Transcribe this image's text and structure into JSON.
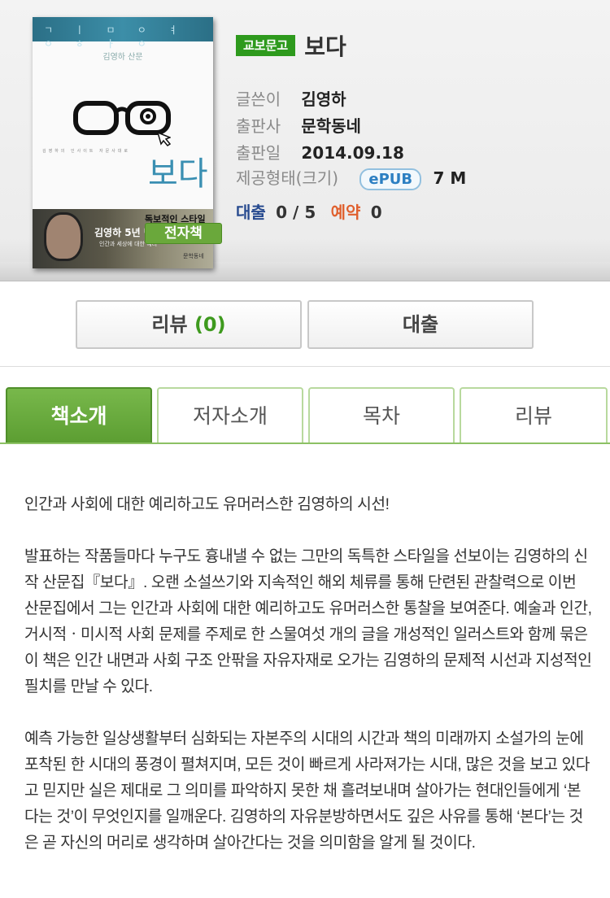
{
  "book": {
    "cover": {
      "top_band_text": "ㄱ ㅣ ㅁ ㅇ ㅕ ㅇ ㅎ ㅏ ㅇ",
      "author_line": "김영하 산문",
      "subtitle_line": "김영하의 인사이트 자문사대로",
      "title": "보다",
      "banner_line1": "독보적인 스타일",
      "banner_line2": "김영하 5년 만",
      "banner_line3": "인간과 세상에 대한 예리",
      "publisher_mark": "문학동네"
    },
    "ebook_badge": "전자책",
    "badge": "교보문고",
    "title": "보다",
    "author_label": "글쓴이",
    "author": "김영하",
    "publisher_label": "출판사",
    "publisher": "문학동네",
    "pubdate_label": "출판일",
    "pubdate": "2014.09.18",
    "format_label": "제공형태(크기)",
    "format": "ePUB",
    "size": "7 M",
    "loan_label": "대출",
    "loan_value": "0 / 5",
    "reserve_label": "예약",
    "reserve_value": "0"
  },
  "actions": {
    "review_label": "리뷰",
    "review_count": "(0)",
    "loan_button": "대출"
  },
  "tabs": [
    {
      "label": "책소개",
      "active": true
    },
    {
      "label": "저자소개",
      "active": false
    },
    {
      "label": "목차",
      "active": false
    },
    {
      "label": "리뷰",
      "active": false
    }
  ],
  "description": {
    "p1": "인간과 사회에 대한 예리하고도 유머러스한 김영하의 시선!",
    "p2": "발표하는 작품들마다 누구도 흉내낼 수 없는 그만의 독특한 스타일을 선보이는 김영하의 신작 산문집『보다』. 오랜 소설쓰기와 지속적인 해외 체류를 통해 단련된 관찰력으로 이번 산문집에서 그는 인간과 사회에 대한 예리하고도 유머러스한 통찰을 보여준다. 예술과 인간, 거시적ㆍ미시적 사회 문제를 주제로 한 스물여섯 개의 글을 개성적인 일러스트와 함께 묶은 이 책은 인간 내면과 사회 구조 안팎을 자유자재로 오가는 김영하의 문제적 시선과 지성적인 필치를 만날 수 있다.",
    "p3": "예측 가능한 일상생활부터 심화되는 자본주의 시대의 시간과 책의 미래까지 소설가의 눈에 포착된 한 시대의 풍경이 펼쳐지며, 모든 것이 빠르게 사라져가는 시대, 많은 것을 보고 있다고 믿지만 실은 제대로 그 의미를 파악하지 못한 채 흘려보내며 살아가는 현대인들에게 ‘본다는 것’이 무엇인지를 일깨운다. 김영하의 자유분방하면서도 깊은 사유를 통해 ‘본다’는 것은 곧 자신의 머리로 생각하며 살아간다는 것을 의미함을 알게 될 것이다."
  }
}
